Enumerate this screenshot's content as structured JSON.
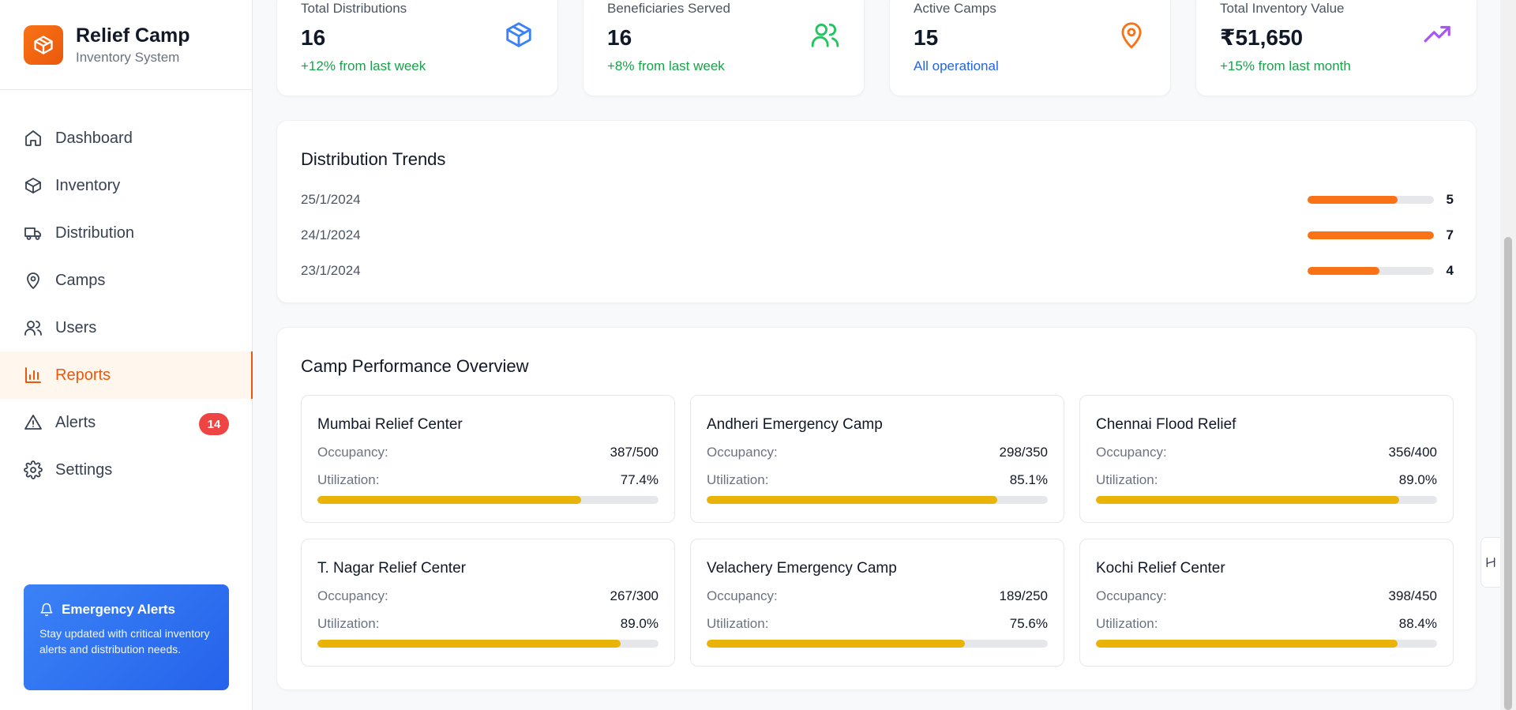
{
  "brand": {
    "title": "Relief Camp",
    "subtitle": "Inventory System"
  },
  "nav": [
    {
      "label": "Dashboard",
      "icon": "home-icon"
    },
    {
      "label": "Inventory",
      "icon": "package-icon"
    },
    {
      "label": "Distribution",
      "icon": "truck-icon"
    },
    {
      "label": "Camps",
      "icon": "map-pin-icon"
    },
    {
      "label": "Users",
      "icon": "users-icon"
    },
    {
      "label": "Reports",
      "icon": "bar-chart-icon",
      "active": true
    },
    {
      "label": "Alerts",
      "icon": "alert-triangle-icon",
      "badge": "14"
    },
    {
      "label": "Settings",
      "icon": "gear-icon"
    }
  ],
  "alert_card": {
    "title": "Emergency Alerts",
    "body": "Stay updated with critical inventory alerts and distribution needs."
  },
  "stats": [
    {
      "title": "Total Distributions",
      "value": "16",
      "note": "+12% from last week",
      "note_color": "#16a34a",
      "icon": "package-icon",
      "icon_color": "#3b82f6"
    },
    {
      "title": "Beneficiaries Served",
      "value": "16",
      "note": "+8% from last week",
      "note_color": "#16a34a",
      "icon": "users-icon",
      "icon_color": "#22c55e"
    },
    {
      "title": "Active Camps",
      "value": "15",
      "note": "All operational",
      "note_color": "#2563eb",
      "icon": "map-pin-icon",
      "icon_color": "#f97316"
    },
    {
      "title": "Total Inventory Value",
      "value": "₹51,650",
      "note": "+15% from last month",
      "note_color": "#16a34a",
      "icon": "trending-up-icon",
      "icon_color": "#a855f7"
    }
  ],
  "trends": {
    "title": "Distribution Trends",
    "max": 7,
    "rows": [
      {
        "date": "25/1/2024",
        "count": 5
      },
      {
        "date": "24/1/2024",
        "count": 7
      },
      {
        "date": "23/1/2024",
        "count": 4
      }
    ]
  },
  "camps": {
    "title": "Camp Performance Overview",
    "occupancy_label": "Occupancy:",
    "utilization_label": "Utilization:",
    "items": [
      {
        "name": "Mumbai Relief Center",
        "occupancy": "387/500",
        "utilization": "77.4%",
        "util_value": 77.4
      },
      {
        "name": "Andheri Emergency Camp",
        "occupancy": "298/350",
        "utilization": "85.1%",
        "util_value": 85.1
      },
      {
        "name": "Chennai Flood Relief",
        "occupancy": "356/400",
        "utilization": "89.0%",
        "util_value": 89.0
      },
      {
        "name": "T. Nagar Relief Center",
        "occupancy": "267/300",
        "utilization": "89.0%",
        "util_value": 89.0
      },
      {
        "name": "Velachery Emergency Camp",
        "occupancy": "189/250",
        "utilization": "75.6%",
        "util_value": 75.6
      },
      {
        "name": "Kochi Relief Center",
        "occupancy": "398/450",
        "utilization": "88.4%",
        "util_value": 88.4
      }
    ]
  },
  "colors": {
    "accent": "#ea580c",
    "trend_bar": "#f97316",
    "util_bar": "#eab308",
    "badge": "#ef4444"
  }
}
